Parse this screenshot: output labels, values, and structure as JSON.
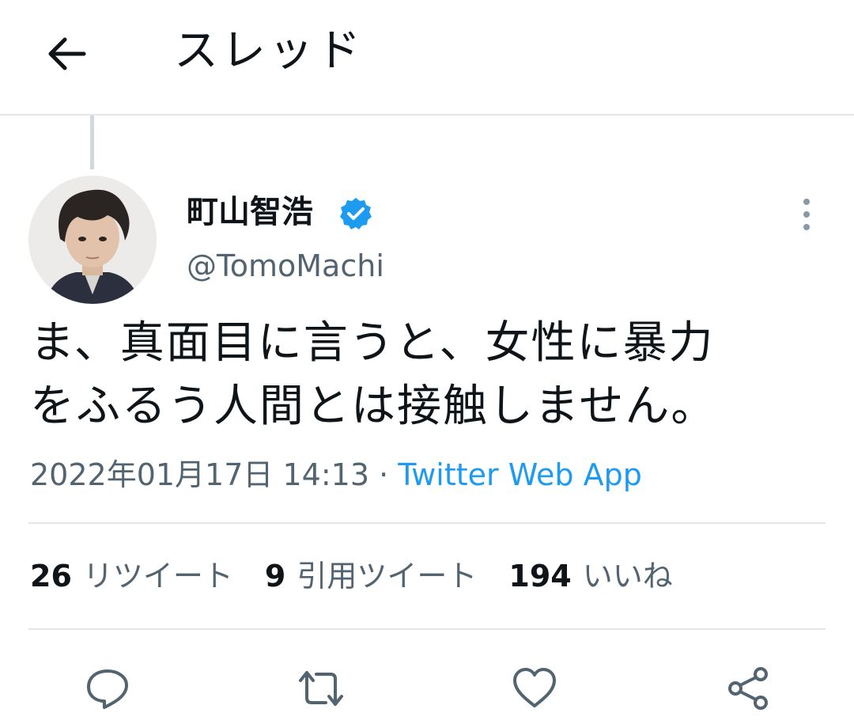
{
  "header": {
    "title": "スレッド",
    "back_icon": "arrow-left-icon"
  },
  "tweet": {
    "display_name": "町山智浩",
    "verified_icon": "verified-badge-icon",
    "handle": "@TomoMachi",
    "text_line1": "ま、真面目に言うと、女性に暴力",
    "text_line2": "をふるう人間とは接触しません。",
    "timestamp": "2022年01月17日 14:13",
    "separator": " · ",
    "source": "Twitter Web App",
    "stats": {
      "retweets_count": "26",
      "retweets_label": "リツイート",
      "quotes_count": "9",
      "quotes_label": "引用ツイート",
      "likes_count": "194",
      "likes_label": "いいね"
    }
  },
  "actions": {
    "reply_icon": "reply-icon",
    "retweet_icon": "retweet-icon",
    "like_icon": "heart-icon",
    "share_icon": "share-icon"
  },
  "colors": {
    "text_primary": "#0f1419",
    "text_secondary": "#536471",
    "link": "#1d9bf0",
    "verified": "#1d9bf0",
    "divider": "#e3e7ea",
    "icon": "#536471"
  }
}
